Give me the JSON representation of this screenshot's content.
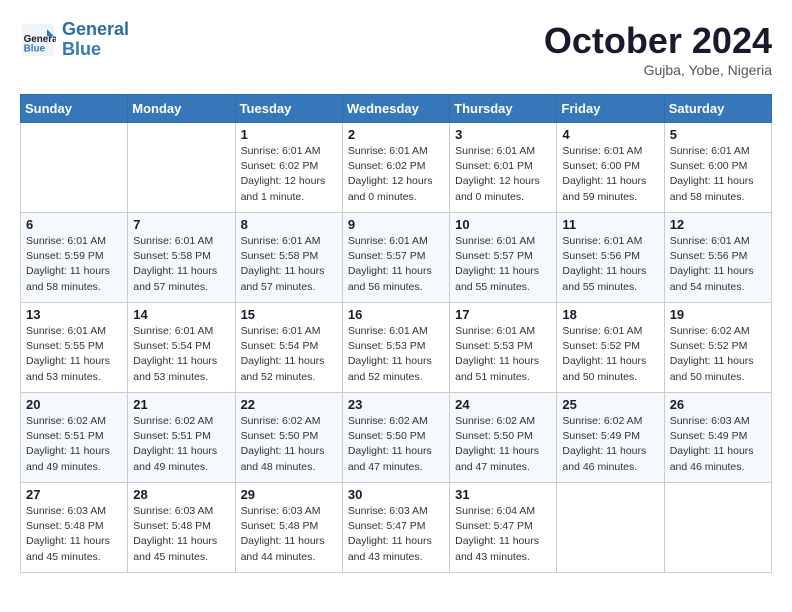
{
  "header": {
    "logo_line1": "General",
    "logo_line2": "Blue",
    "month": "October 2024",
    "location": "Gujba, Yobe, Nigeria"
  },
  "weekdays": [
    "Sunday",
    "Monday",
    "Tuesday",
    "Wednesday",
    "Thursday",
    "Friday",
    "Saturday"
  ],
  "weeks": [
    [
      {
        "day": "",
        "info": ""
      },
      {
        "day": "",
        "info": ""
      },
      {
        "day": "1",
        "info": "Sunrise: 6:01 AM\nSunset: 6:02 PM\nDaylight: 12 hours\nand 1 minute."
      },
      {
        "day": "2",
        "info": "Sunrise: 6:01 AM\nSunset: 6:02 PM\nDaylight: 12 hours\nand 0 minutes."
      },
      {
        "day": "3",
        "info": "Sunrise: 6:01 AM\nSunset: 6:01 PM\nDaylight: 12 hours\nand 0 minutes."
      },
      {
        "day": "4",
        "info": "Sunrise: 6:01 AM\nSunset: 6:00 PM\nDaylight: 11 hours\nand 59 minutes."
      },
      {
        "day": "5",
        "info": "Sunrise: 6:01 AM\nSunset: 6:00 PM\nDaylight: 11 hours\nand 58 minutes."
      }
    ],
    [
      {
        "day": "6",
        "info": "Sunrise: 6:01 AM\nSunset: 5:59 PM\nDaylight: 11 hours\nand 58 minutes."
      },
      {
        "day": "7",
        "info": "Sunrise: 6:01 AM\nSunset: 5:58 PM\nDaylight: 11 hours\nand 57 minutes."
      },
      {
        "day": "8",
        "info": "Sunrise: 6:01 AM\nSunset: 5:58 PM\nDaylight: 11 hours\nand 57 minutes."
      },
      {
        "day": "9",
        "info": "Sunrise: 6:01 AM\nSunset: 5:57 PM\nDaylight: 11 hours\nand 56 minutes."
      },
      {
        "day": "10",
        "info": "Sunrise: 6:01 AM\nSunset: 5:57 PM\nDaylight: 11 hours\nand 55 minutes."
      },
      {
        "day": "11",
        "info": "Sunrise: 6:01 AM\nSunset: 5:56 PM\nDaylight: 11 hours\nand 55 minutes."
      },
      {
        "day": "12",
        "info": "Sunrise: 6:01 AM\nSunset: 5:56 PM\nDaylight: 11 hours\nand 54 minutes."
      }
    ],
    [
      {
        "day": "13",
        "info": "Sunrise: 6:01 AM\nSunset: 5:55 PM\nDaylight: 11 hours\nand 53 minutes."
      },
      {
        "day": "14",
        "info": "Sunrise: 6:01 AM\nSunset: 5:54 PM\nDaylight: 11 hours\nand 53 minutes."
      },
      {
        "day": "15",
        "info": "Sunrise: 6:01 AM\nSunset: 5:54 PM\nDaylight: 11 hours\nand 52 minutes."
      },
      {
        "day": "16",
        "info": "Sunrise: 6:01 AM\nSunset: 5:53 PM\nDaylight: 11 hours\nand 52 minutes."
      },
      {
        "day": "17",
        "info": "Sunrise: 6:01 AM\nSunset: 5:53 PM\nDaylight: 11 hours\nand 51 minutes."
      },
      {
        "day": "18",
        "info": "Sunrise: 6:01 AM\nSunset: 5:52 PM\nDaylight: 11 hours\nand 50 minutes."
      },
      {
        "day": "19",
        "info": "Sunrise: 6:02 AM\nSunset: 5:52 PM\nDaylight: 11 hours\nand 50 minutes."
      }
    ],
    [
      {
        "day": "20",
        "info": "Sunrise: 6:02 AM\nSunset: 5:51 PM\nDaylight: 11 hours\nand 49 minutes."
      },
      {
        "day": "21",
        "info": "Sunrise: 6:02 AM\nSunset: 5:51 PM\nDaylight: 11 hours\nand 49 minutes."
      },
      {
        "day": "22",
        "info": "Sunrise: 6:02 AM\nSunset: 5:50 PM\nDaylight: 11 hours\nand 48 minutes."
      },
      {
        "day": "23",
        "info": "Sunrise: 6:02 AM\nSunset: 5:50 PM\nDaylight: 11 hours\nand 47 minutes."
      },
      {
        "day": "24",
        "info": "Sunrise: 6:02 AM\nSunset: 5:50 PM\nDaylight: 11 hours\nand 47 minutes."
      },
      {
        "day": "25",
        "info": "Sunrise: 6:02 AM\nSunset: 5:49 PM\nDaylight: 11 hours\nand 46 minutes."
      },
      {
        "day": "26",
        "info": "Sunrise: 6:03 AM\nSunset: 5:49 PM\nDaylight: 11 hours\nand 46 minutes."
      }
    ],
    [
      {
        "day": "27",
        "info": "Sunrise: 6:03 AM\nSunset: 5:48 PM\nDaylight: 11 hours\nand 45 minutes."
      },
      {
        "day": "28",
        "info": "Sunrise: 6:03 AM\nSunset: 5:48 PM\nDaylight: 11 hours\nand 45 minutes."
      },
      {
        "day": "29",
        "info": "Sunrise: 6:03 AM\nSunset: 5:48 PM\nDaylight: 11 hours\nand 44 minutes."
      },
      {
        "day": "30",
        "info": "Sunrise: 6:03 AM\nSunset: 5:47 PM\nDaylight: 11 hours\nand 43 minutes."
      },
      {
        "day": "31",
        "info": "Sunrise: 6:04 AM\nSunset: 5:47 PM\nDaylight: 11 hours\nand 43 minutes."
      },
      {
        "day": "",
        "info": ""
      },
      {
        "day": "",
        "info": ""
      }
    ]
  ]
}
